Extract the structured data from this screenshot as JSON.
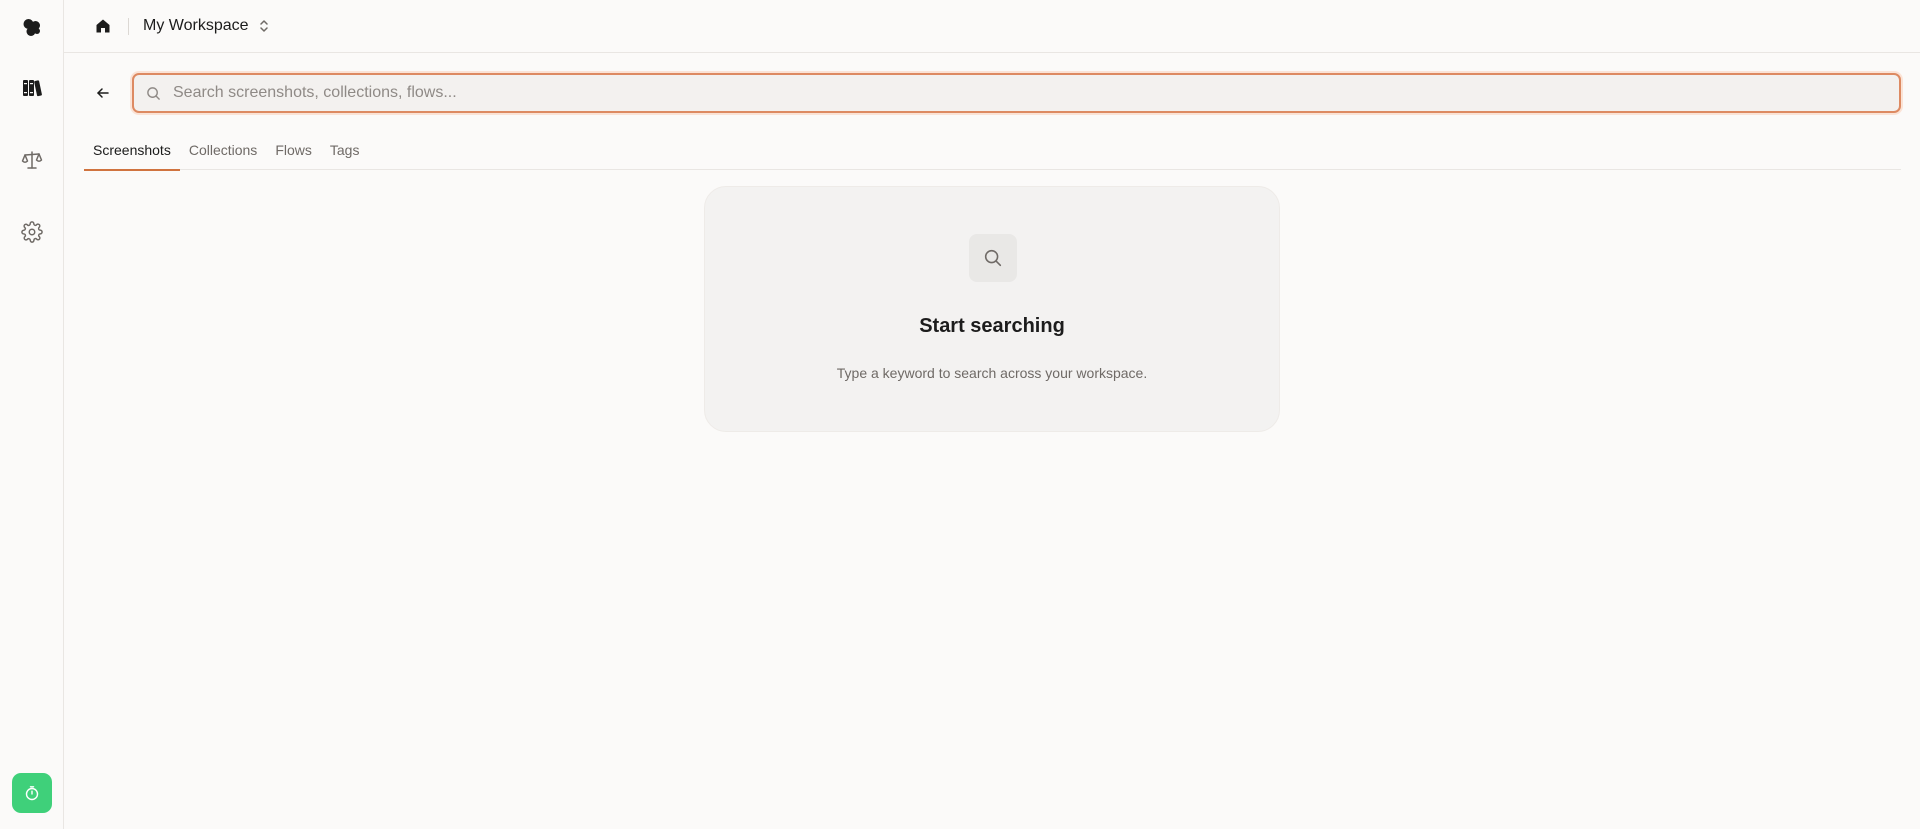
{
  "topbar": {
    "workspace_name": "My Workspace"
  },
  "search": {
    "value": "",
    "placeholder": "Search screenshots, collections, flows..."
  },
  "tabs": [
    {
      "label": "Screenshots",
      "active": true
    },
    {
      "label": "Collections",
      "active": false
    },
    {
      "label": "Flows",
      "active": false
    },
    {
      "label": "Tags",
      "active": false
    }
  ],
  "empty_state": {
    "title": "Start searching",
    "description": "Type a keyword to search across your workspace."
  },
  "icons": {
    "rail": [
      "logo-icon",
      "library-icon",
      "balance-icon",
      "settings-icon",
      "timer-icon"
    ],
    "topbar": [
      "home-icon",
      "chevron-up-down-icon"
    ],
    "search": [
      "back-arrow-icon",
      "search-icon"
    ]
  },
  "colors": {
    "accent": "#d0733f",
    "focus_border": "#dd8a62",
    "timer_button": "#3fd07a",
    "background": "#fbfaf9"
  }
}
